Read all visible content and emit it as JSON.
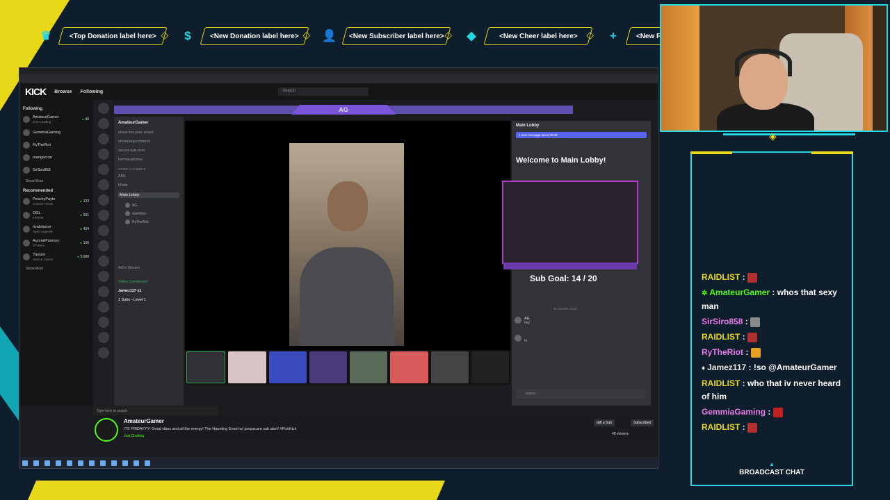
{
  "alerts": [
    {
      "icon": "crown-icon",
      "glyph": "♛",
      "label": "<Top Donation label here>"
    },
    {
      "icon": "dollar-icon",
      "glyph": "$",
      "label": "<New Donation label here>"
    },
    {
      "icon": "person-icon",
      "glyph": "👤",
      "label": "<New Subscriber label here>"
    },
    {
      "icon": "gem-icon",
      "glyph": "◆",
      "label": "<New Cheer label here>"
    },
    {
      "icon": "plus-icon",
      "glyph": "+",
      "label": "<New Follower label here>"
    }
  ],
  "kick": {
    "logo": "KICK",
    "nav": [
      "Browse",
      "Following"
    ],
    "search_placeholder": "Search",
    "following_title": "Following",
    "following": [
      {
        "name": "AmateurGamer",
        "sub": "Just Chatting",
        "count": "40"
      },
      {
        "name": "GemmiaGaming",
        "sub": "",
        "count": ""
      },
      {
        "name": "RyTheRiot",
        "sub": "",
        "count": ""
      },
      {
        "name": "orangecron",
        "sub": "",
        "count": ""
      },
      {
        "name": "SirSiro858",
        "sub": "",
        "count": ""
      }
    ],
    "show_more": "Show More",
    "recommended_title": "Recommended",
    "recommended": [
      {
        "name": "PeachyPaytn",
        "sub": "Crimson Snow",
        "count": "123"
      },
      {
        "name": "OGL",
        "sub": "Fortnite",
        "count": "501"
      },
      {
        "name": "rivalsfactor",
        "sub": "Apex Legends",
        "count": "434"
      },
      {
        "name": "AuroraPhoenyx",
        "sub": "VTubers",
        "count": "106"
      },
      {
        "name": "Yassuo",
        "sub": "Slots & Casino",
        "count": "5,080"
      }
    ],
    "show_more2": "Show More"
  },
  "discord": {
    "server": "AmateurGamer",
    "channels": [
      "show-me-your-snack",
      "showmeyourmerch",
      "secret-sub-chat",
      "homes-photos"
    ],
    "voice_cat": "VOICE CHANNELS",
    "voice_channels": [
      "AFK",
      "Mods",
      "Main Lobby"
    ],
    "users": [
      "AG",
      "Gremlins",
      "RyTheRiot"
    ],
    "ag_stream": "AG's Stream",
    "video_connected": "Video Connected",
    "user_line": "Jamez117 x1",
    "sub_line": "1 Subs - Level 1",
    "chat_header": "Main Lobby",
    "new_msg": "1 new message since 00:38",
    "welcome": "Welcome to Main Lobby!",
    "sub_goal": "Sub Goal: 14 / 20",
    "date": "21 October 2023",
    "msgs": [
      {
        "user": "AG",
        "text": "hey"
      },
      {
        "user": "",
        "text": "hi"
      }
    ],
    "input_value": "ooooo",
    "overlay_badge": "AG"
  },
  "stream": {
    "name": "AmateurGamer",
    "title": "ITS FRIDAYYY! Good vibes and all the energy! The Haunting Event w/ jumpscare sub alert! #PickKick",
    "category": "Just Chatting",
    "viewers": "40 viewers",
    "gift_btn": "Gift a Sub",
    "sub_btn": "Subscribed",
    "search_placeholder": "Type here to search"
  },
  "chat": [
    {
      "user": "RAIDLIST",
      "color": "#e8d81a",
      "badge": "",
      "text": "",
      "emote": "#b03030"
    },
    {
      "user": "AmateurGamer",
      "color": "#53fc18",
      "badge": "✲",
      "text": "whos that sexy man",
      "emote": ""
    },
    {
      "user": "SirSiro858",
      "color": "#e87ae8",
      "badge": "",
      "text": "",
      "emote": "#888888"
    },
    {
      "user": "RAIDLIST",
      "color": "#e8d81a",
      "badge": "",
      "text": "",
      "emote": "#b03030"
    },
    {
      "user": "RyTheRiot",
      "color": "#e87ae8",
      "badge": "",
      "text": "",
      "emote": "#e8a020"
    },
    {
      "user": "Jamez117",
      "color": "#e8e8e8",
      "badge": "♦",
      "text": "!so @AmateurGamer",
      "emote": ""
    },
    {
      "user": "RAIDLIST",
      "color": "#e8d81a",
      "badge": "",
      "text": "who that iv never heard of him",
      "emote": ""
    },
    {
      "user": "GemmiaGaming",
      "color": "#e87ae8",
      "badge": "",
      "text": "",
      "emote": "#c02020"
    },
    {
      "user": "RAIDLIST",
      "color": "#e8d81a",
      "badge": "",
      "text": "",
      "emote": "#b03030"
    }
  ],
  "chat_footer": "BROADCAST CHAT",
  "colors": {
    "accent_teal": "#27d7e6",
    "accent_yellow": "#e8d81a",
    "kick_green": "#53fc18",
    "background": "#0f1e2c"
  }
}
